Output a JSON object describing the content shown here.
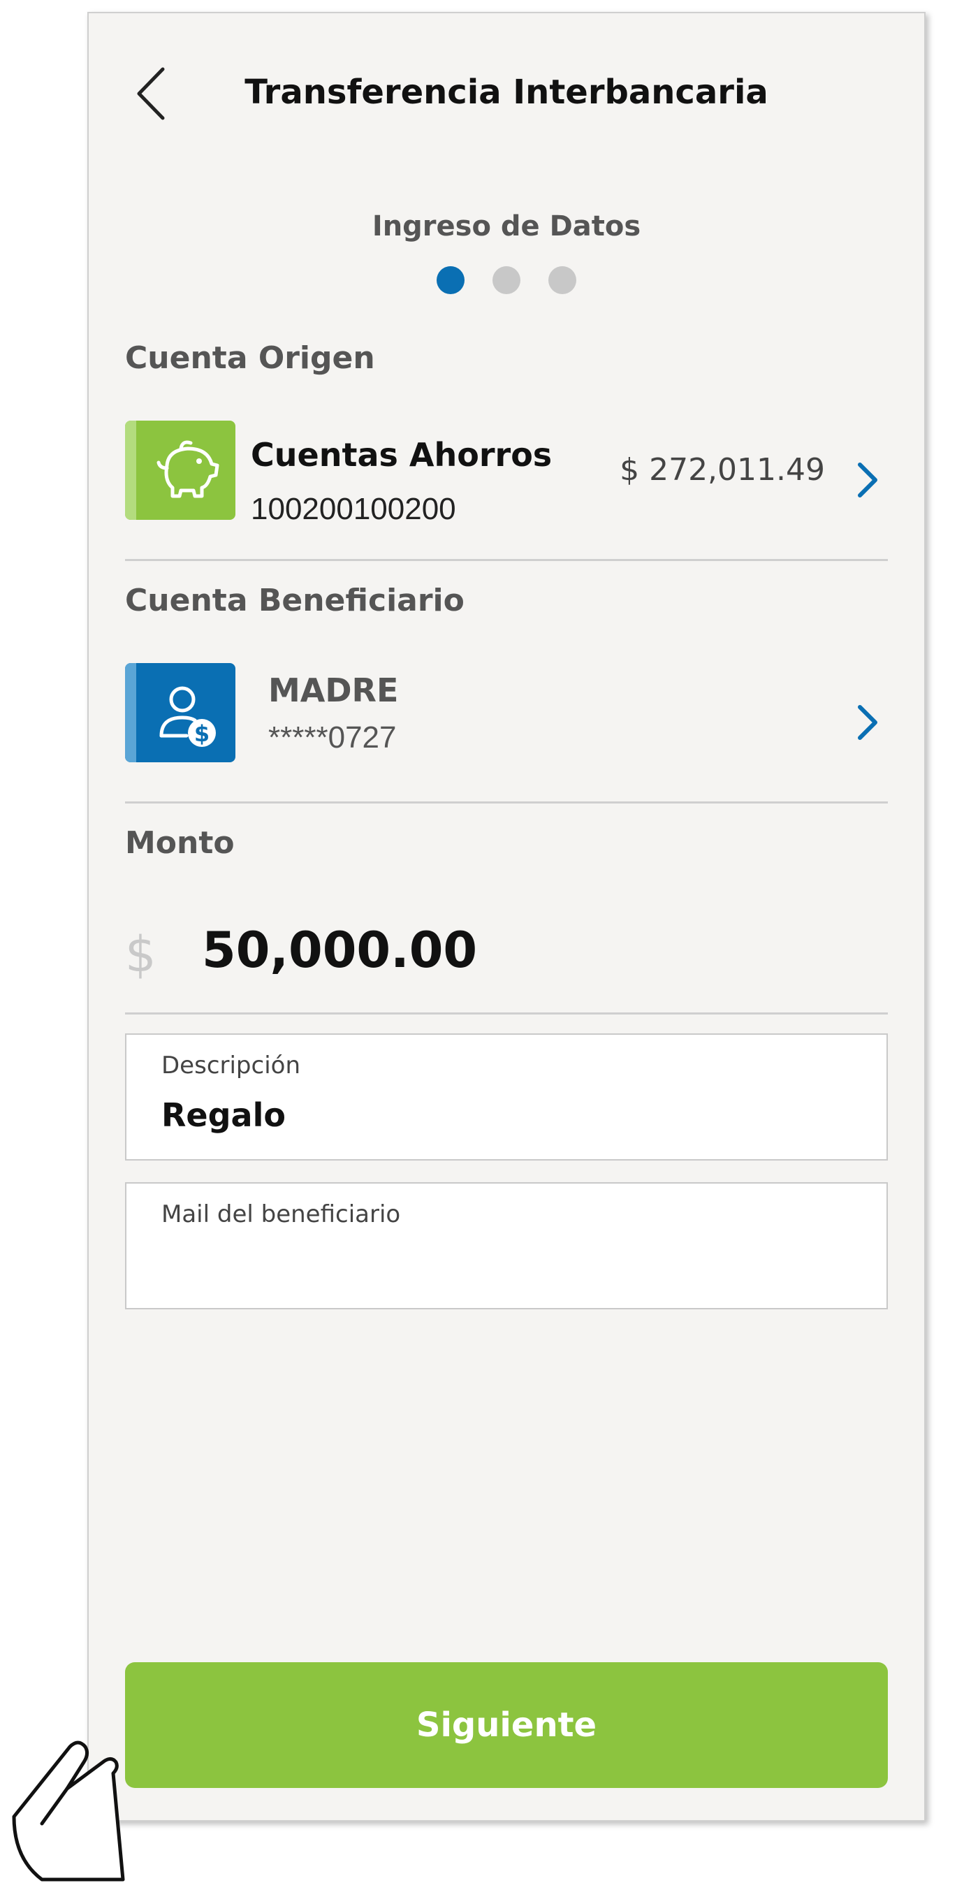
{
  "header": {
    "title": "Transferencia Interbancaria",
    "step_label": "Ingreso de Datos",
    "steps_total": 3,
    "active_step": 1
  },
  "origin": {
    "section_label": "Cuenta Origen",
    "account_name": "Cuentas Ahorros",
    "account_number": "100200100200",
    "balance": "$ 272,011.49",
    "icon": "piggy-bank-icon",
    "icon_color": "#8cc43f"
  },
  "beneficiary": {
    "section_label": "Cuenta Beneficiario",
    "name": "MADRE",
    "account_masked": "*****0727",
    "icon": "user-money-icon",
    "icon_color": "#0a6fb3"
  },
  "amount": {
    "section_label": "Monto",
    "currency_symbol": "$",
    "value": "50,000.00"
  },
  "description": {
    "label": "Descripción",
    "value": "Regalo"
  },
  "email": {
    "label": "Mail del beneficiario",
    "value": ""
  },
  "actions": {
    "next_label": "Siguiente"
  },
  "colors": {
    "accent_blue": "#0a6fb3",
    "accent_green": "#8cc43f",
    "background": "#f5f4f2"
  }
}
